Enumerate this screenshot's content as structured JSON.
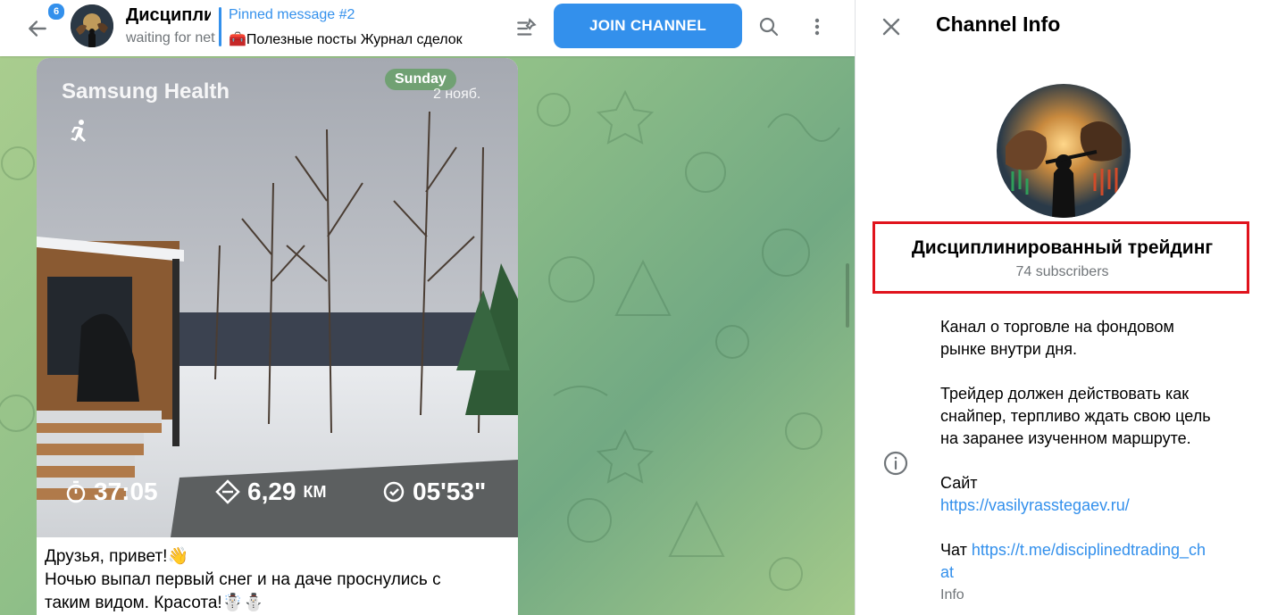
{
  "header": {
    "unread_count": "6",
    "channel_title": "Дисциплинированный трейдинг",
    "channel_status": "waiting for network...",
    "pinned_label": "Pinned message #2",
    "pinned_text": "🧰Полезные посты Журнал сделок",
    "join_label": "JOIN CHANNEL"
  },
  "message": {
    "photo": {
      "app_name": "Samsung Health",
      "day_badge": "Sunday",
      "date": "2 нояб.",
      "duration": "37:05",
      "distance": "6,29",
      "distance_unit": "КМ",
      "pace": "05'53\""
    },
    "caption_lines": [
      "Друзья, привет!👋",
      "Ночью выпал первый снег и на даче проснулись с",
      "таким видом. Красота!☃️⛄"
    ]
  },
  "info_panel": {
    "title": "Channel Info",
    "name": "Дисциплинированный трейдинг",
    "subscribers": "74 subscribers",
    "description_p1_l1": "Канал о торговле на фондовом",
    "description_p1_l2": "рынке внутри дня.",
    "description_p2_l1": "Трейдер должен действовать как",
    "description_p2_l2": "снайпер, терпливо ждать свою цель",
    "description_p2_l3": "на заранее изученном маршруте.",
    "site_label": "Сайт",
    "site_url": "https://vasilyrasstegaev.ru/",
    "chat_label": "Чат",
    "chat_url_l1": "https://t.me/disciplinedtrading_ch",
    "chat_url_l2": "at",
    "info_label": "Info"
  },
  "colors": {
    "accent": "#3390ec",
    "highlight_border": "#e0131c",
    "secondary_text": "#707579"
  },
  "icons": [
    "back-arrow-icon",
    "pinned-list-icon",
    "search-icon",
    "more-vertical-icon",
    "close-icon",
    "info-icon",
    "running-icon",
    "timer-icon",
    "distance-icon",
    "pace-icon"
  ]
}
